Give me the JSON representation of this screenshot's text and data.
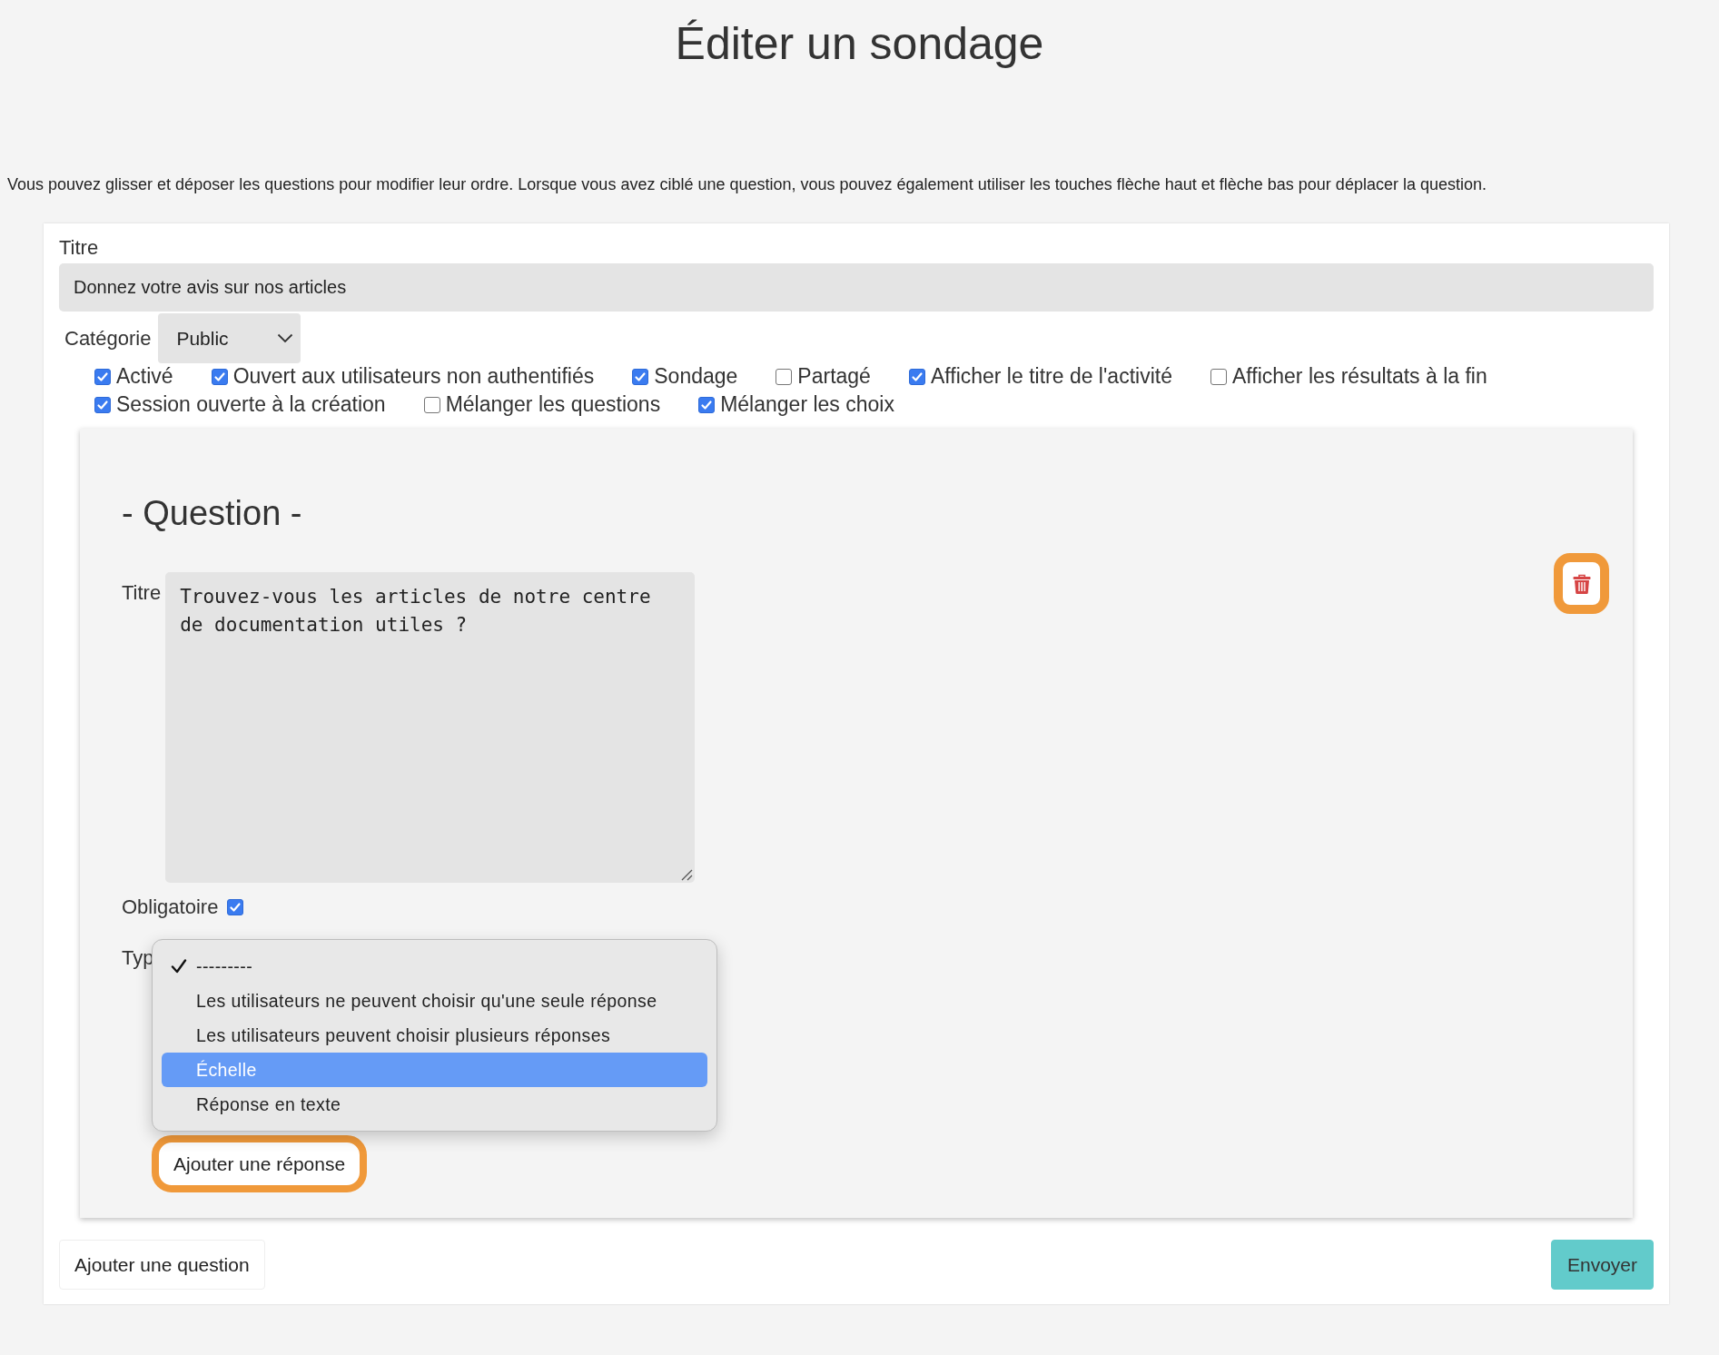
{
  "page_title": "Éditer un sondage",
  "instructions": "Vous pouvez glisser et déposer les questions pour modifier leur ordre. Lorsque vous avez ciblé une question, vous pouvez également utiliser les touches flèche haut et flèche bas pour déplacer la question.",
  "form": {
    "title_label": "Titre",
    "title_value": "Donnez votre avis sur nos articles",
    "category_label": "Catégorie",
    "category_value": "Public",
    "options": [
      {
        "label": "Activé",
        "checked": true
      },
      {
        "label": "Ouvert aux utilisateurs non authentifiés",
        "checked": true
      },
      {
        "label": "Sondage",
        "checked": true
      },
      {
        "label": "Partagé",
        "checked": false
      },
      {
        "label": "Afficher le titre de l'activité",
        "checked": true
      },
      {
        "label": "Afficher les résultats à la fin",
        "checked": false
      },
      {
        "label": "Session ouverte à la création",
        "checked": true
      },
      {
        "label": "Mélanger les questions",
        "checked": false
      },
      {
        "label": "Mélanger les choix",
        "checked": true
      }
    ],
    "question": {
      "heading": "- Question -",
      "title_label": "Titre",
      "title_value": "Trouvez-vous les articles de notre centre de documentation utiles ?",
      "delete_highlighted": true,
      "required_label": "Obligatoire",
      "required_checked": true,
      "type_label": "Typ",
      "type_menu": [
        {
          "label": "---------",
          "checked": true,
          "selected": false
        },
        {
          "label": "Les utilisateurs ne peuvent choisir qu'une seule réponse",
          "checked": false,
          "selected": false
        },
        {
          "label": "Les utilisateurs peuvent choisir plusieurs réponses",
          "checked": false,
          "selected": false
        },
        {
          "label": "Échelle",
          "checked": false,
          "selected": true
        },
        {
          "label": "Réponse en texte",
          "checked": false,
          "selected": false
        }
      ],
      "add_answer": {
        "label": "Ajouter une réponse",
        "highlighted": true
      }
    },
    "add_question_button": "Ajouter une question",
    "submit_button": "Envoyer"
  }
}
